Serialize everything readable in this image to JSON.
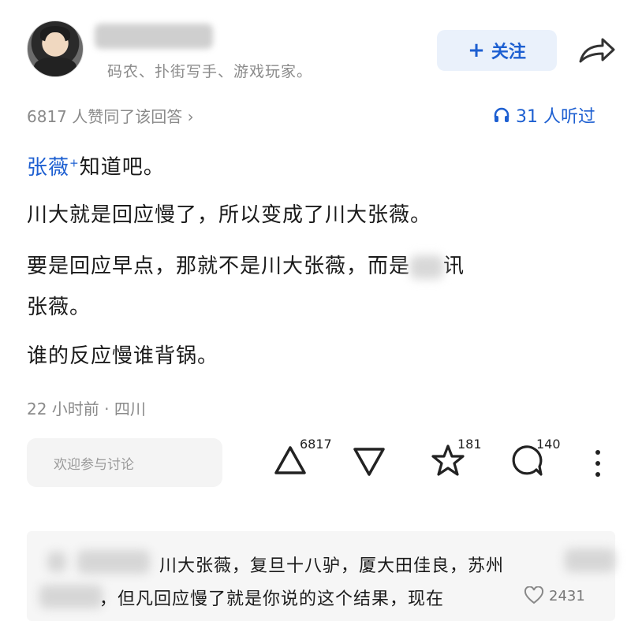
{
  "author": {
    "bio": "码农、扑街写手、游戏玩家。",
    "follow_label": "关注"
  },
  "stats": {
    "agree_text": "6817 人赞同了该回答 ›",
    "listen_text": "31 人听过"
  },
  "answer": {
    "line1_mention": "张薇",
    "line1_rest": "知道吧。",
    "line2": "川大就是回应慢了，所以变成了川大张薇。",
    "line3_a": "要是回应早点，那就不是川大张薇，而是",
    "line3_b": "讯",
    "line4": "张薇。",
    "line5": "谁的反应慢谁背锅。"
  },
  "meta": "22 小时前 · 四川",
  "actions": {
    "comment_placeholder": "欢迎参与讨论",
    "upvote_count": "6817",
    "star_count": "181",
    "comment_count": "140"
  },
  "reply": {
    "line1": "川大张薇，复旦十八驴，厦大田佳良，苏州",
    "line2": "，但凡回应慢了就是你说的这个结果，现在",
    "likes": "2431"
  },
  "colors": {
    "accent_blue": "#1d5fd1",
    "muted_gray": "#8a8a8a"
  }
}
